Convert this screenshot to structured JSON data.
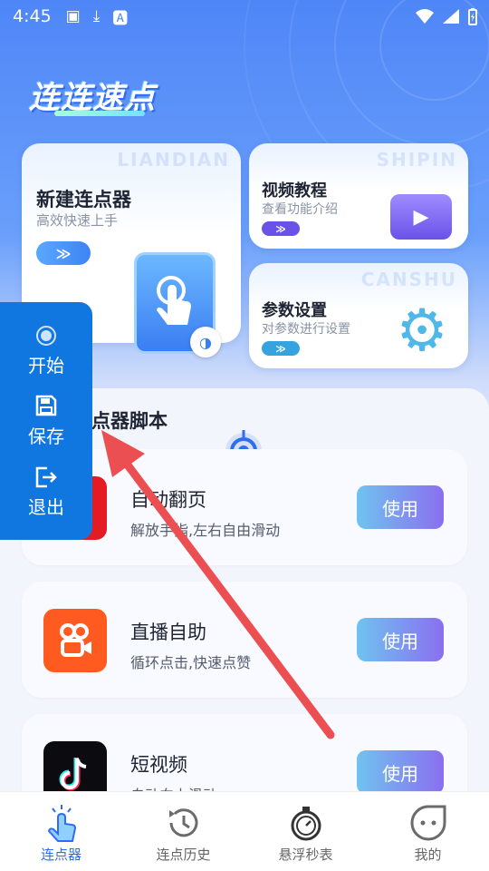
{
  "status_bar": {
    "time": "4:45",
    "icons": [
      "image-icon",
      "download-icon",
      "a-icon"
    ],
    "right_icons": [
      "wifi-icon",
      "signal-icon",
      "battery-icon"
    ]
  },
  "app": {
    "title": "连连速点"
  },
  "cards": {
    "new": {
      "watermark": "LIANDIAN",
      "title": "新建连点器",
      "subtitle": "高效快速上手",
      "go": "≫"
    },
    "video": {
      "watermark": "SHIPIN",
      "title": "视频教程",
      "subtitle": "查看功能介绍",
      "go": "≫"
    },
    "params": {
      "watermark": "CANSHU",
      "title": "参数设置",
      "subtitle": "对参数进行设置",
      "go": "≫"
    }
  },
  "section": {
    "title": "连点器脚本"
  },
  "scripts": [
    {
      "name": "自动翻页",
      "desc": "解放手指,左右自由滑动",
      "button": "使用",
      "icon": "book-icon",
      "color": "#e31b23"
    },
    {
      "name": "直播自助",
      "desc": "循环点击,快速点赞",
      "button": "使用",
      "icon": "kuaishou-icon",
      "color": "#ff5a1f"
    },
    {
      "name": "短视频",
      "desc": "自动向上滑动",
      "button": "使用",
      "icon": "tiktok-icon",
      "color": "#0b0b10"
    }
  ],
  "float_menu": {
    "start": "开始",
    "save": "保存",
    "exit": "退出"
  },
  "nav": [
    {
      "label": "连点器",
      "icon": "tap-hand-icon",
      "active": true
    },
    {
      "label": "连点历史",
      "icon": "history-icon",
      "active": false
    },
    {
      "label": "悬浮秒表",
      "icon": "stopwatch-icon",
      "active": false
    },
    {
      "label": "我的",
      "icon": "profile-face-icon",
      "active": false
    }
  ],
  "colors": {
    "accent": "#2f6df0",
    "float_menu": "#1177e0",
    "arrow": "#ec4f52"
  }
}
